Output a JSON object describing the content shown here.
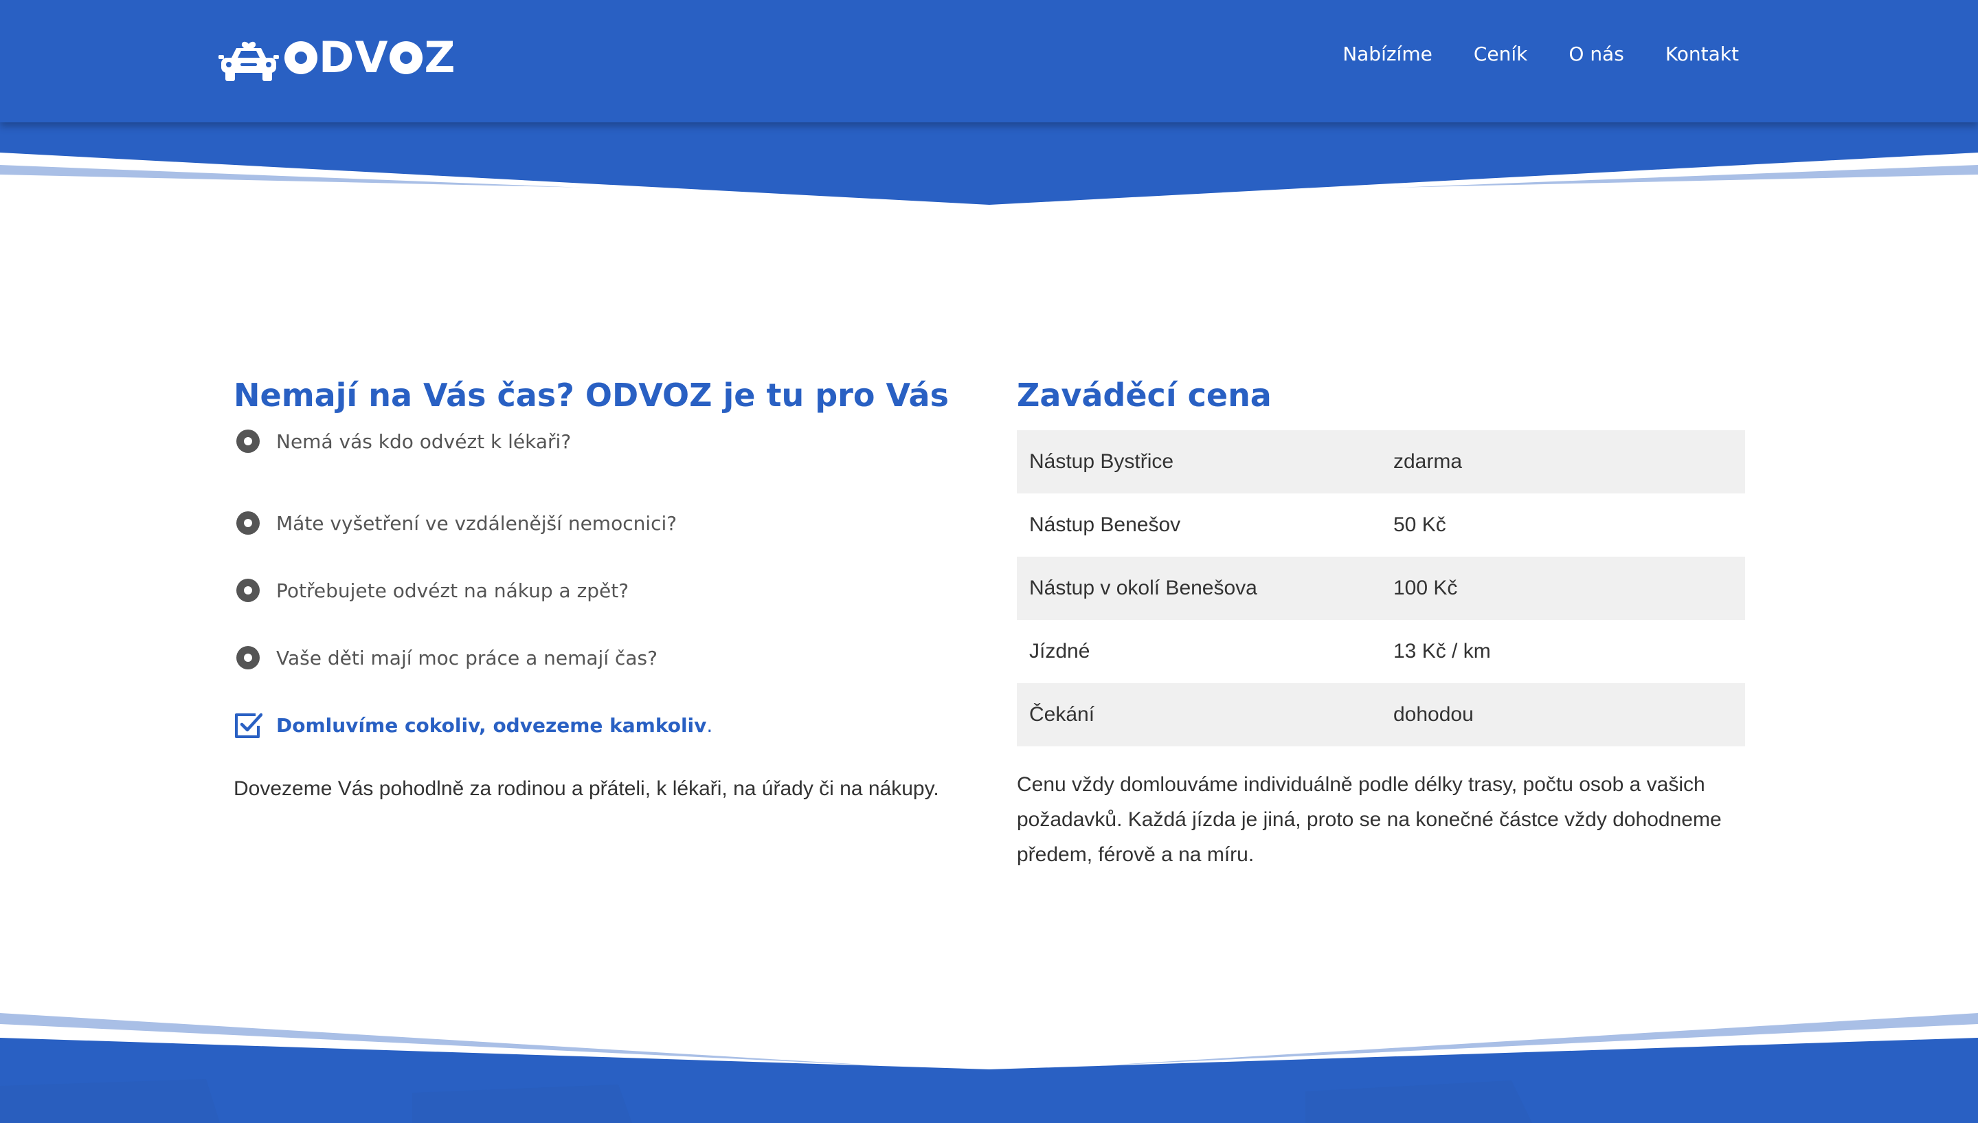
{
  "header": {
    "logo_text": "ODVOZ",
    "nav": [
      {
        "label": "Nabízíme"
      },
      {
        "label": "Ceník"
      },
      {
        "label": "O nás"
      },
      {
        "label": "Kontakt"
      }
    ]
  },
  "left": {
    "title": "Nemají na Vás čas? ODVOZ je tu pro Vás",
    "questions": [
      {
        "text": "Nemá vás kdo odvézt k lékaři?"
      },
      {
        "text": "Máte vyšetření ve vzdálenější nemocnici?"
      },
      {
        "text": "Potřebujete odvézt na nákup a zpět?"
      },
      {
        "text": "Vaše děti mají moc práce a nemají čas?"
      }
    ],
    "highlight": {
      "text": "Domluvíme cokoliv, odvezeme kamkoliv",
      "dot": "."
    },
    "paragraph": "Dovezeme Vás pohodlně za rodinou a přáteli, k lékaři, na úřady či na nákupy."
  },
  "right": {
    "title": "Zaváděcí cena",
    "prices": [
      {
        "item": "Nástup Bystřice",
        "price": "zdarma"
      },
      {
        "item": "Nástup Benešov",
        "price": "50 Kč"
      },
      {
        "item": "Nástup v okolí Benešova",
        "price": "100 Kč"
      },
      {
        "item": "Jízdné",
        "price": "13 Kč / km"
      },
      {
        "item": "Čekání",
        "price": "dohodou"
      }
    ],
    "paragraph": "Cenu vždy domlouváme individuálně podle délky trasy, počtu osob a vašich požadavků. Každá jízda je jiná, proto se na konečné částce vždy dohodneme předem, férově a na míru."
  },
  "colors": {
    "brand_blue": "#2960c3",
    "light_blue": "#a9bfe6",
    "text_dark": "#333333",
    "text_gray": "#555555",
    "row_gray": "#f0f0f0"
  },
  "icons": [
    "car-logo-icon",
    "heart-icon",
    "radio-bullet-icon",
    "checkbox-icon"
  ]
}
